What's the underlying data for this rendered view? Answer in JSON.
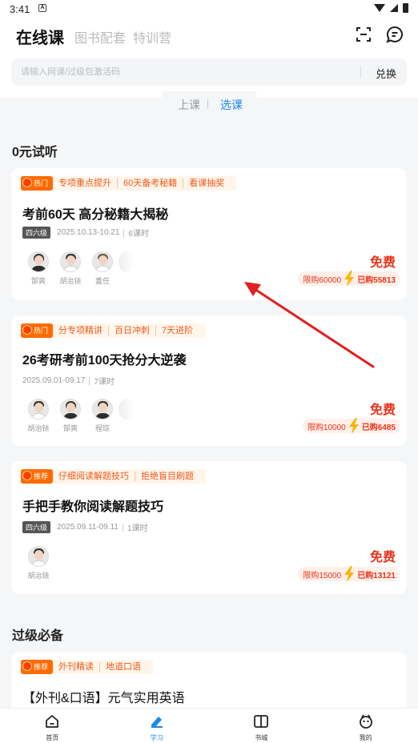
{
  "status": {
    "time": "3:41",
    "notif_icon": "A"
  },
  "header": {
    "tabs": [
      {
        "label": "在线课",
        "active": true
      },
      {
        "label": "图书配套",
        "active": false
      },
      {
        "label": "特训营",
        "active": false
      }
    ]
  },
  "search": {
    "placeholder": "请输入网课/过级包激活码",
    "redeem_label": "兑换"
  },
  "segment": {
    "left": "上课",
    "right": "选课",
    "selected": "选课"
  },
  "sections": [
    {
      "title": "0元试听"
    },
    {
      "title": "过级必备"
    }
  ],
  "cards": [
    {
      "badge": "热门",
      "tags": [
        "专项重点提升",
        "60天备考秘籍",
        "看课抽奖"
      ],
      "title": "考前60天 高分秘籍大揭秘",
      "level": "四六级",
      "dates": "2025.10.13-10.21",
      "hours": "6课时",
      "teachers": [
        "郜爽",
        "胡治铱",
        "蓋任"
      ],
      "price": "免费",
      "limit": "限购60000",
      "sold": "已购55813"
    },
    {
      "badge": "热门",
      "tags": [
        "分专项精讲",
        "百日冲刺",
        "7天进阶"
      ],
      "title": "26考研考前100天抢分大逆袭",
      "level": "",
      "dates": "2025.09.01-09.17",
      "hours": "7课时",
      "teachers": [
        "胡治铱",
        "郜爽",
        "程琮"
      ],
      "price": "免费",
      "limit": "限购10000",
      "sold": "已购6485"
    },
    {
      "badge": "推荐",
      "tags": [
        "仔细阅读解题技巧",
        "拒绝盲目刷题"
      ],
      "title": "手把手教你阅读解题技巧",
      "level": "四六级",
      "dates": "2025.09.11-09.11",
      "hours": "1课时",
      "teachers": [
        "胡治铱"
      ],
      "price": "免费",
      "limit": "限购15000",
      "sold": "已购13121"
    },
    {
      "badge": "推荐",
      "tags": [
        "外刊精读",
        "地道口语"
      ],
      "title": "【外刊&口语】元气实用英语"
    }
  ],
  "nav": [
    {
      "label": "首页",
      "icon": "home-icon"
    },
    {
      "label": "学习",
      "icon": "study-icon",
      "active": true
    },
    {
      "label": "书城",
      "icon": "book-icon"
    },
    {
      "label": "我的",
      "icon": "profile-icon"
    }
  ],
  "colors": {
    "accent": "#1e88e5",
    "price": "#e8341c",
    "tag": "#f05a1a",
    "badge": "#ff6a00",
    "annotation_arrow": "#e02020"
  }
}
